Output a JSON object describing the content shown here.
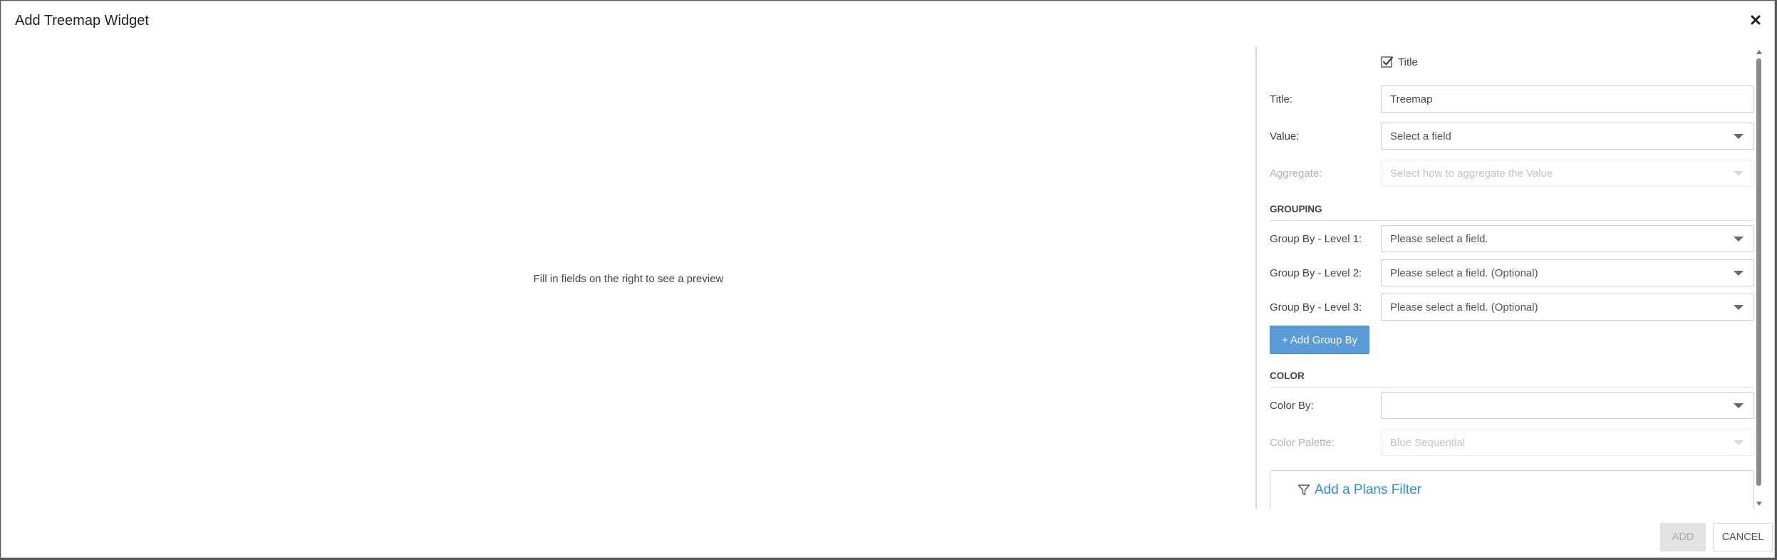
{
  "dialog": {
    "title": "Add Treemap Widget",
    "close_icon": "close-icon",
    "preview_message": "Fill in fields on the right to see a preview"
  },
  "panel": {
    "title_checkbox": {
      "label": "Title",
      "checked": true
    },
    "title_field": {
      "label": "Title:",
      "value": "Treemap"
    },
    "value_field": {
      "label": "Value:",
      "value": "Select a field"
    },
    "aggregate_field": {
      "label": "Aggregate:",
      "value": "Select how to aggregate the Value",
      "disabled": true
    },
    "grouping": {
      "header": "GROUPING",
      "levels": [
        {
          "label": "Group By - Level 1:",
          "value": "Please select a field."
        },
        {
          "label": "Group By - Level 2:",
          "value": "Please select a field. (Optional)"
        },
        {
          "label": "Group By - Level 3:",
          "value": "Please select a field. (Optional)"
        }
      ],
      "add_button": "+ Add Group By"
    },
    "color": {
      "header": "COLOR",
      "color_by": {
        "label": "Color By:",
        "value": ""
      },
      "palette": {
        "label": "Color Palette:",
        "value": "Blue Sequential",
        "disabled": true
      }
    },
    "filter": {
      "label": "Add a Plans Filter",
      "icon": "filter-icon"
    }
  },
  "footer": {
    "add_label": "ADD",
    "add_disabled": true,
    "cancel_label": "CANCEL"
  },
  "colors": {
    "accent": "#5b9bd9",
    "link": "#2a8ed0"
  }
}
